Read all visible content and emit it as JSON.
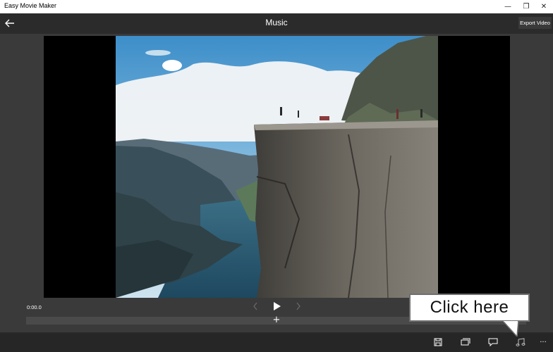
{
  "app": {
    "title": "Easy Movie Maker"
  },
  "window_controls": {
    "minimize": "—",
    "restore": "❐",
    "close": "✕"
  },
  "header": {
    "title": "Music",
    "export_label": "Export Video"
  },
  "player": {
    "time": "0:00.0",
    "add_symbol": "+"
  },
  "callout": {
    "text": "Click here"
  },
  "toolbar": {
    "icons": [
      "save-icon",
      "slides-icon",
      "caption-icon",
      "music-icon",
      "more-icon"
    ],
    "more_label": "···"
  },
  "colors": {
    "background": "#2b2b2b",
    "stage": "#3a3a3a",
    "timeline": "#4a4a4a",
    "bottombar": "#262626"
  }
}
